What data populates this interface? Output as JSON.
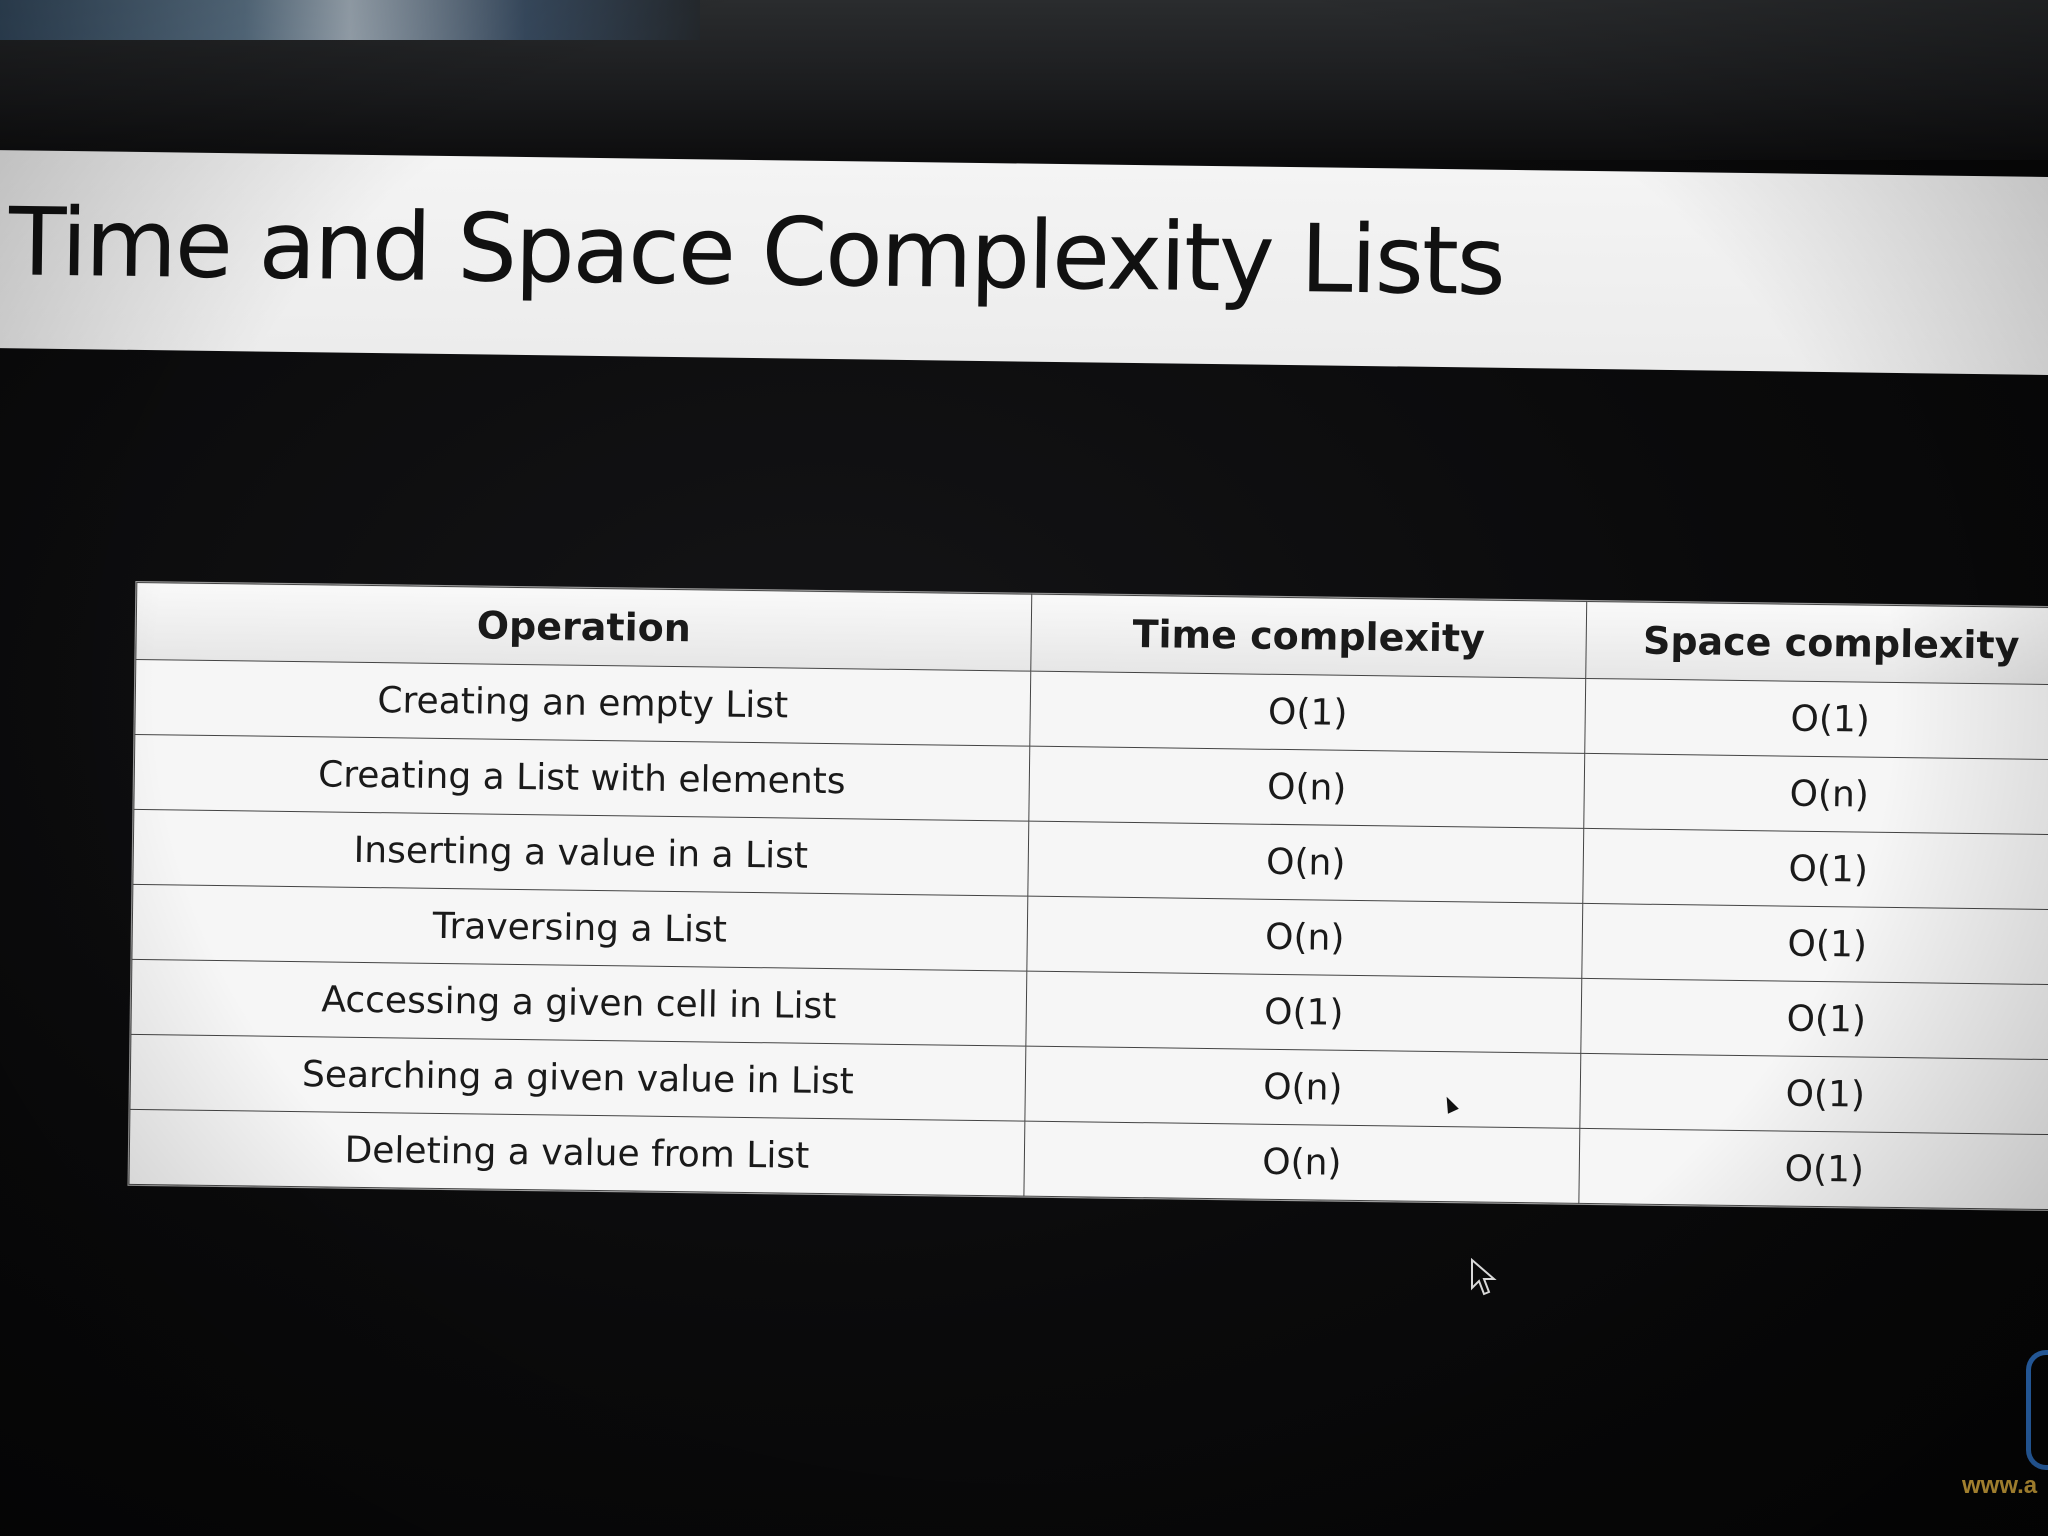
{
  "slide": {
    "title": "Time and Space Complexity Lists"
  },
  "table": {
    "headers": [
      "Operation",
      "Time complexity",
      "Space complexity"
    ],
    "rows": [
      [
        "Creating an empty List",
        "O(1)",
        "O(1)"
      ],
      [
        "Creating a List with elements",
        "O(n)",
        "O(n)"
      ],
      [
        "Inserting a value in a List",
        "O(n)",
        "O(1)"
      ],
      [
        "Traversing a List",
        "O(n)",
        "O(1)"
      ],
      [
        "Accessing a given cell in List",
        "O(1)",
        "O(1)"
      ],
      [
        "Searching a given value in List",
        "O(n)",
        "O(1)"
      ],
      [
        "Deleting a value from List",
        "O(n)",
        "O(1)"
      ]
    ]
  },
  "footer": {
    "logo_text": "www.a"
  },
  "icons": {
    "cursor": "mouse-pointer-icon",
    "logo": "brace-logo-icon"
  },
  "colors": {
    "title_band": "#efefef",
    "table_bg": "#f4f4f4",
    "grid": "#444444",
    "text": "#1a1a1a",
    "logo_blue": "#2f74c8",
    "logo_text": "#e3b341"
  }
}
